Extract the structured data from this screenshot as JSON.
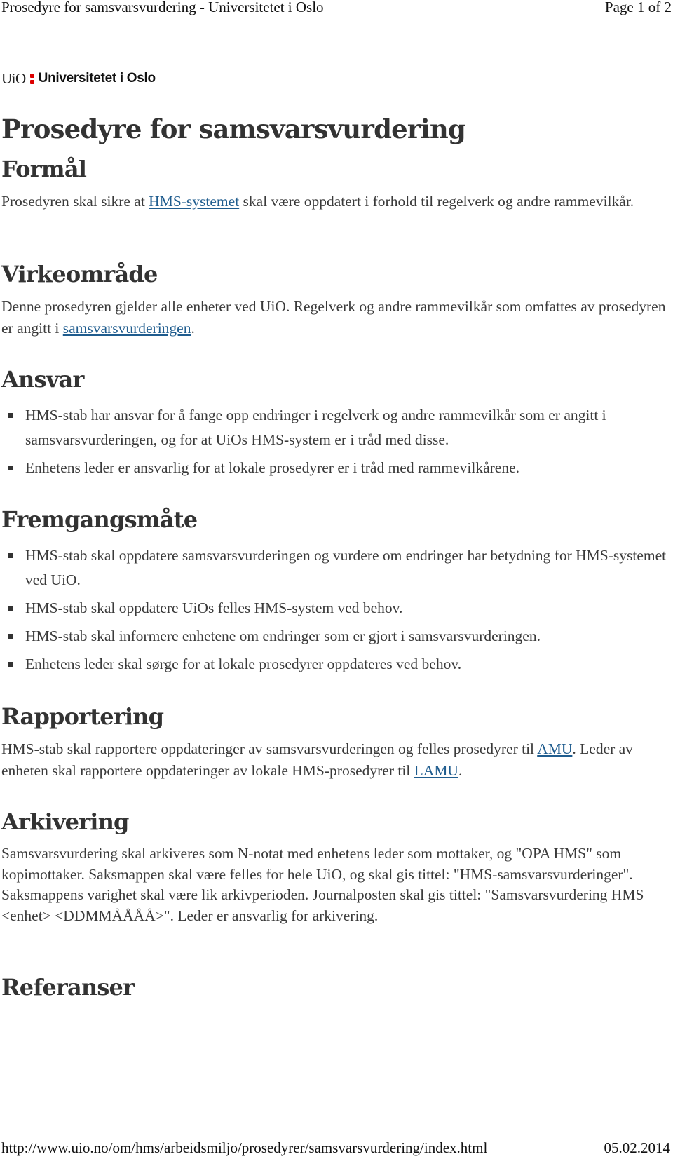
{
  "print_header": {
    "title": "Prosedyre for samsvarsvurdering - Universitetet i Oslo",
    "page": "Page 1 of 2"
  },
  "logo": {
    "short": "UiO",
    "name": "Universitetet i Oslo",
    "accent_color": "#dd0000"
  },
  "page_title": "Prosedyre for samsvarsvurdering",
  "sections": {
    "formal": {
      "heading": "Formål",
      "text_before": "Prosedyren skal sikre at ",
      "link": "HMS-systemet",
      "text_after": " skal være oppdatert i forhold til regelverk og andre rammevilkår."
    },
    "virkeomrade": {
      "heading": "Virkeområde",
      "text_before": "Denne prosedyren gjelder alle enheter ved UiO. Regelverk og andre rammevilkår som omfattes av prosedyren er angitt i ",
      "link": "samsvarsvurderingen",
      "text_after": "."
    },
    "ansvar": {
      "heading": "Ansvar",
      "items": [
        "HMS-stab har ansvar for å fange opp endringer i regelverk og andre rammevilkår som er angitt i samsvarsvurderingen, og for at UiOs HMS-system er i tråd med disse.",
        "Enhetens leder er ansvarlig for at lokale prosedyrer er i tråd med rammevilkårene."
      ]
    },
    "fremgangsmate": {
      "heading": "Fremgangsmåte",
      "items": [
        "HMS-stab skal oppdatere samsvarsvurderingen og vurdere om endringer har betydning for HMS-systemet ved UiO.",
        "HMS-stab skal oppdatere UiOs felles HMS-system ved behov.",
        "HMS-stab skal informere enhetene om endringer som er gjort i samsvarsvurderingen.",
        "Enhetens leder skal sørge for at lokale prosedyrer oppdateres ved behov."
      ]
    },
    "rapportering": {
      "heading": "Rapportering",
      "text_before": "HMS-stab skal rapportere oppdateringer av samsvarsvurderingen og felles prosedyrer til ",
      "link1": "AMU",
      "text_middle": ". Leder av enheten skal rapportere oppdateringer av lokale HMS-prosedyrer til ",
      "link2": "LAMU",
      "text_after": "."
    },
    "arkivering": {
      "heading": "Arkivering",
      "text": "Samsvarsvurdering skal arkiveres som N-notat med enhetens leder som mottaker, og \"OPA HMS\" som kopimottaker. Saksmappen skal være felles for hele UiO, og skal gis tittel: \"HMS-samsvarsvurderinger\". Saksmappens varighet skal være lik arkivperioden. Journalposten skal gis tittel: \"Samsvarsvurdering HMS <enhet> <DDMMÅÅÅÅ>\". Leder er ansvarlig for arkivering."
    },
    "referanser": {
      "heading": "Referanser"
    }
  },
  "print_footer": {
    "url": "http://www.uio.no/om/hms/arbeidsmiljo/prosedyrer/samsvarsvurdering/index.html",
    "date": "05.02.2014"
  }
}
